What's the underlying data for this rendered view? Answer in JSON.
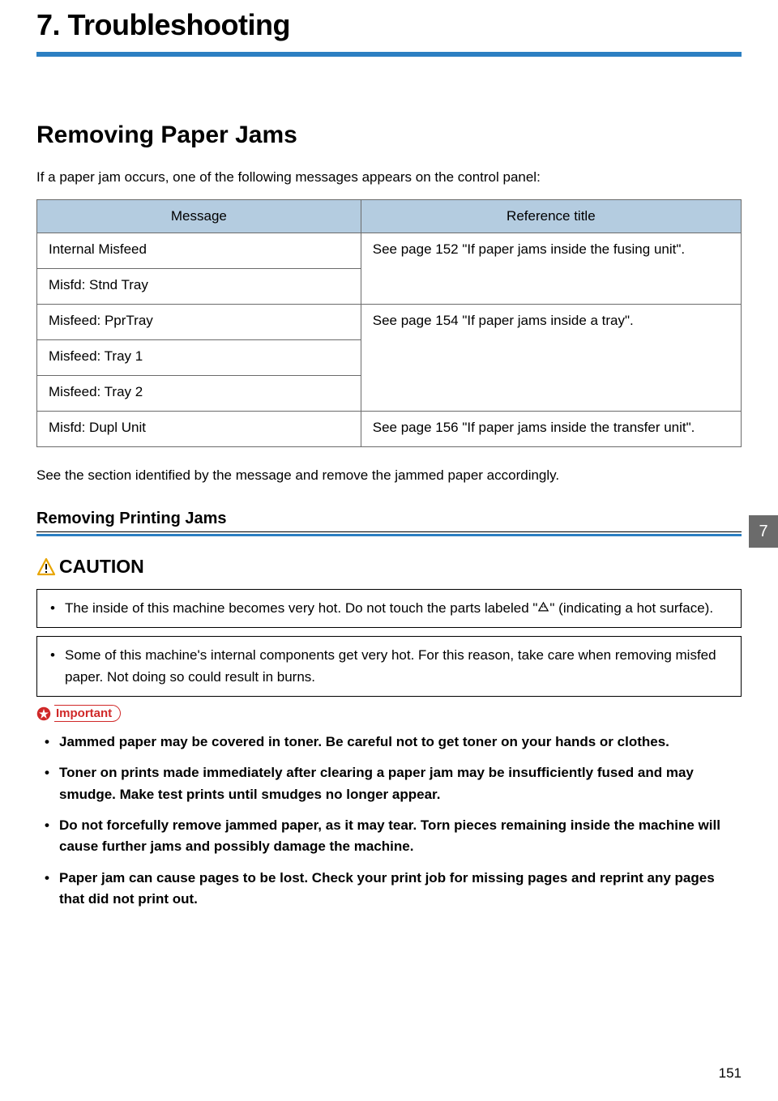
{
  "chapter_title": "7. Troubleshooting",
  "section_title": "Removing Paper Jams",
  "intro_para": "If a paper jam occurs, one of the following messages appears on the control panel:",
  "table": {
    "headers": {
      "message": "Message",
      "reference": "Reference title"
    },
    "rows": {
      "r1_msg": "Internal Misfeed",
      "r2_msg": "Misfd: Stnd Tray",
      "ref_fusing": "See page 152 \"If paper jams inside the fusing unit\".",
      "r3_msg": "Misfeed: PprTray",
      "r4_msg": "Misfeed: Tray 1",
      "r5_msg": "Misfeed: Tray 2",
      "ref_tray": "See page 154 \"If paper jams inside a tray\".",
      "r6_msg": "Misfd: Dupl Unit",
      "ref_transfer": "See page 156 \"If paper jams inside the transfer unit\"."
    }
  },
  "after_table_para": "See the section identified by the message and remove the jammed paper accordingly.",
  "subsection_title": "Removing Printing Jams",
  "caution_label": "CAUTION",
  "caution_box_1_pre": "The inside of this machine becomes very hot. Do not touch the parts labeled \"",
  "caution_box_1_post": "\" (indicating a hot surface).",
  "caution_box_2": "Some of this machine's internal components get very hot. For this reason, take care when removing misfed paper. Not doing so could result in burns.",
  "important_label": "Important",
  "important_items": {
    "i1": "Jammed paper may be covered in toner. Be careful not to get toner on your hands or clothes.",
    "i2": "Toner on prints made immediately after clearing a paper jam may be insufficiently fused and may smudge. Make test prints until smudges no longer appear.",
    "i3": "Do not forcefully remove jammed paper, as it may tear. Torn pieces remaining inside the machine will cause further jams and possibly damage the machine.",
    "i4": "Paper jam can cause pages to be lost. Check your print job for missing pages and reprint any pages that did not print out."
  },
  "tab_number": "7",
  "page_number": "151"
}
